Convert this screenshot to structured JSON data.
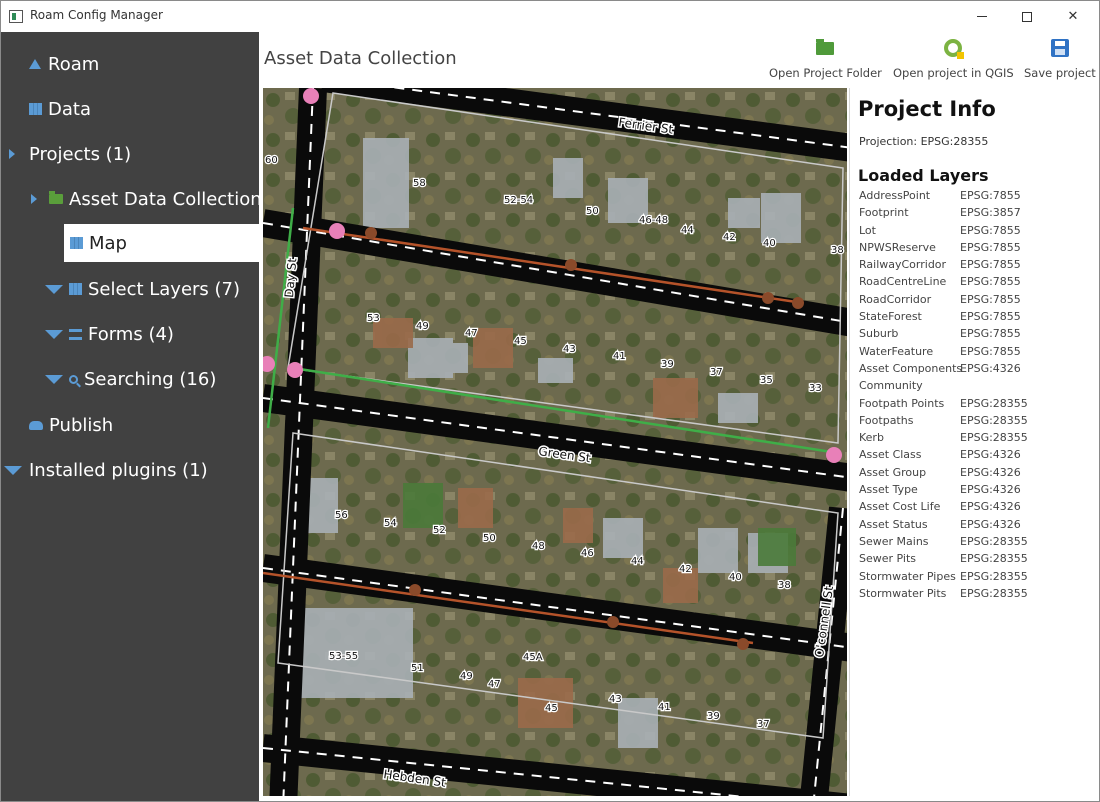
{
  "window": {
    "title": "Roam Config Manager"
  },
  "sidebar": {
    "items": [
      {
        "label": "Roam",
        "icon": "triangle-icon"
      },
      {
        "label": "Data",
        "icon": "map-icon"
      },
      {
        "label": "Projects (1)",
        "icon": "caret-right-icon"
      },
      {
        "label": "Asset Data Collection",
        "icon": "folder-icon"
      },
      {
        "label": "Map",
        "icon": "map-icon",
        "selected": true
      },
      {
        "label": "Select Layers (7)",
        "icon": "map-icon"
      },
      {
        "label": "Forms (4)",
        "icon": "form-icon"
      },
      {
        "label": "Searching (16)",
        "icon": "search-icon"
      },
      {
        "label": "Publish",
        "icon": "publish-icon"
      },
      {
        "label": "Installed plugins (1)",
        "icon": "caret-down-icon"
      }
    ]
  },
  "header": {
    "title": "Asset Data Collection",
    "open_folder_label": "Open Project Folder",
    "open_qgis_label": "Open project in QGIS",
    "save_label": "Save project"
  },
  "map": {
    "street_labels": [
      "Ferrier St",
      "Day St",
      "Green St",
      "O'connell St",
      "Hebden St"
    ],
    "lot_numbers": [
      "60",
      "58",
      "52-54",
      "50",
      "46-48",
      "44",
      "42",
      "40",
      "38",
      "53",
      "49",
      "47",
      "45",
      "43",
      "41",
      "39",
      "37",
      "35",
      "33",
      "56",
      "54",
      "52",
      "50",
      "48",
      "46",
      "44",
      "42",
      "40",
      "38",
      "53-55",
      "51",
      "49",
      "47",
      "45A",
      "45",
      "43",
      "41",
      "39",
      "37"
    ]
  },
  "info": {
    "title": "Project Info",
    "projection": "Projection: EPSG:28355",
    "layers_title": "Loaded Layers",
    "layers": [
      {
        "name": "AddressPoint",
        "crs": "EPSG:7855"
      },
      {
        "name": "Footprint",
        "crs": "EPSG:3857"
      },
      {
        "name": "Lot",
        "crs": "EPSG:7855"
      },
      {
        "name": "NPWSReserve",
        "crs": "EPSG:7855"
      },
      {
        "name": "RailwayCorridor",
        "crs": "EPSG:7855"
      },
      {
        "name": "RoadCentreLine",
        "crs": "EPSG:7855"
      },
      {
        "name": "RoadCorridor",
        "crs": "EPSG:7855"
      },
      {
        "name": "StateForest",
        "crs": "EPSG:7855"
      },
      {
        "name": "Suburb",
        "crs": "EPSG:7855"
      },
      {
        "name": "WaterFeature",
        "crs": "EPSG:7855"
      },
      {
        "name": "Asset Components",
        "crs": "EPSG:4326"
      },
      {
        "name": "Community",
        "crs": ""
      },
      {
        "name": "Footpath Points",
        "crs": "EPSG:28355"
      },
      {
        "name": "Footpaths",
        "crs": "EPSG:28355"
      },
      {
        "name": "Kerb",
        "crs": "EPSG:28355"
      },
      {
        "name": "Asset Class",
        "crs": "EPSG:4326"
      },
      {
        "name": "Asset Group",
        "crs": "EPSG:4326"
      },
      {
        "name": "Asset Type",
        "crs": "EPSG:4326"
      },
      {
        "name": "Asset Cost Life",
        "crs": "EPSG:4326"
      },
      {
        "name": "Asset Status",
        "crs": "EPSG:4326"
      },
      {
        "name": "Sewer Mains",
        "crs": "EPSG:28355"
      },
      {
        "name": "Sewer Pits",
        "crs": "EPSG:28355"
      },
      {
        "name": "Stormwater Pipes",
        "crs": "EPSG:28355"
      },
      {
        "name": "Stormwater Pits",
        "crs": "EPSG:28355"
      }
    ]
  }
}
